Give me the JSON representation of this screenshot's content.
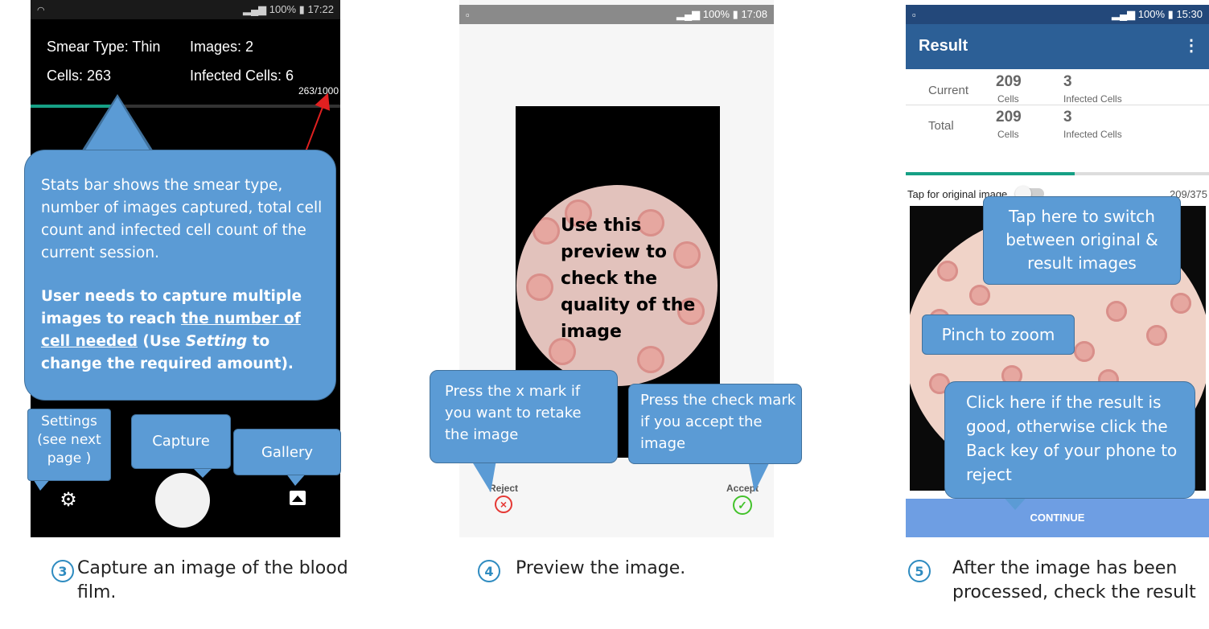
{
  "panel1": {
    "status_time": "17:22",
    "status_battery": "100%",
    "stats": {
      "smear_type": "Smear Type: Thin",
      "images": "Images: 2",
      "cells": "Cells: 263",
      "infected": "Infected Cells: 6",
      "progress": "263/1000",
      "progress_fraction": 0.263
    },
    "callout_stats": {
      "line1": "Stats bar shows the smear type, number of images captured, total cell count and infected cell count of the current session.",
      "line2_prefix": "User needs to capture multiple images to reach ",
      "line2_underline": "the number of cell needed",
      "line2_mid": " (Use ",
      "line2_italic": "Setting",
      "line2_suffix": " to change the required amount)."
    },
    "callout_settings": "Settings (see next page )",
    "callout_capture": "Capture",
    "callout_gallery": "Gallery",
    "caption_number": "3",
    "caption": "Capture an image of the blood film."
  },
  "panel2": {
    "status_time": "17:08",
    "status_battery": "100%",
    "overlay_text": "Use this preview to check the quality of the image",
    "callout_reject": "Press the x mark if you want to retake the image",
    "callout_accept": "Press the check mark if you accept the image",
    "reject_label": "Reject",
    "accept_label": "Accept",
    "caption_number": "4",
    "caption": "Preview the image."
  },
  "panel3": {
    "status_time": "15:30",
    "status_battery": "100%",
    "title": "Result",
    "rows": [
      {
        "label": "Current",
        "cells": "209",
        "cells_unit": "Cells",
        "infected": "3",
        "infected_unit": "Infected Cells"
      },
      {
        "label": "Total",
        "cells": "209",
        "cells_unit": "Cells",
        "infected": "3",
        "infected_unit": "Infected Cells"
      }
    ],
    "progress": "209/375",
    "progress_fraction": 0.557,
    "toggle_label": "Tap for original image",
    "callout_switch": "Tap here to switch between original & result images",
    "callout_zoom": "Pinch to zoom",
    "callout_continue": "Click here if the result is good, otherwise click the Back key of your phone to reject",
    "continue_label": "CONTINUE",
    "caption_number": "5",
    "caption": "After the image has been processed, check the result"
  },
  "colors": {
    "callout": "#5b9bd5",
    "callout_border": "#41719c",
    "app_bar": "#2c5f96",
    "continue": "#6e9ee3",
    "progress": "#16a085",
    "reject": "#e53935",
    "accept": "#43c22b"
  }
}
